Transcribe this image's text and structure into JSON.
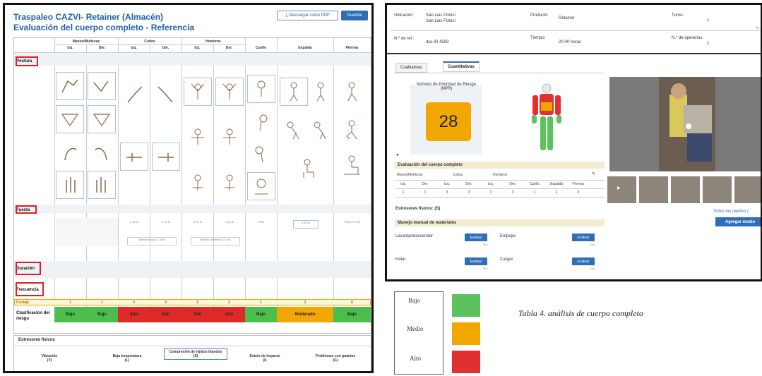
{
  "left": {
    "title1": "Traspaleo CAZVI- Retainer (Almacén)",
    "title2": "Evaluación del cuerpo completo - Referencia",
    "download_label": "Descargar como PDF",
    "save_label": "Guardar",
    "groups": [
      "Manos/Muñecas",
      "Codos",
      "Hombros"
    ],
    "columns": [
      "Izq.",
      "Der.",
      "Izq.",
      "Der.",
      "Izq.",
      "Der.",
      "Cuello",
      "Espalda",
      "Piernas"
    ],
    "sections": {
      "postura": "Postura",
      "fuerza": "Fuerza",
      "duracion": "Duración",
      "frecuencia": "Frecuencia",
      "puntaje": "Puntaje",
      "clasificacion": "Clasificación del riesgo"
    },
    "puntaje_values": [
      "1",
      "1",
      "3",
      "3",
      "3",
      "3",
      "1",
      "2",
      "0"
    ],
    "classification": [
      {
        "label": "Bajo",
        "color": "#4cbe4c"
      },
      {
        "label": "Bajo",
        "color": "#4cbe4c"
      },
      {
        "label": "Alto",
        "color": "#e02a2a"
      },
      {
        "label": "Alto",
        "color": "#e02a2a"
      },
      {
        "label": "Alto",
        "color": "#e02a2a"
      },
      {
        "label": "Alto",
        "color": "#e02a2a"
      },
      {
        "label": "Bajo",
        "color": "#4cbe4c"
      },
      {
        "label": "Moderado",
        "color": "#f0a800"
      },
      {
        "label": "Bajo",
        "color": "#4cbe4c"
      }
    ],
    "stressors_title": "Estresores físicos",
    "stressors": [
      {
        "label": "Vibración",
        "code": "(V)"
      },
      {
        "label": "Baja temperatura",
        "code": "(L)"
      },
      {
        "label": "Compresión de tejidos blandos",
        "code": "(S)"
      },
      {
        "label": "Estrés de impacto",
        "code": "(I)"
      },
      {
        "label": "Problemas con guantes",
        "code": "(G)"
      }
    ]
  },
  "right": {
    "ubicacion_label": "Ubicación:",
    "ubicacion_value1": "San Luis Potosí",
    "ubicacion_value2": "San Luis Potosí",
    "producto_label": "Producto:",
    "producto_value": "Retainer",
    "turno_label": "Turno:",
    "turno_value": "1",
    "ref_label": "N.º de ref.:",
    "ref_value": "doc ID 4593",
    "tiempo_label": "Tiempo:",
    "tiempo_value": "20-40 horas",
    "operarios_label": "N.º de operarios:",
    "operarios_value": "1",
    "tab_cual": "Cualitativas",
    "tab_cuant": "Cuantitativas",
    "npr_label": "Número de Prioridad de Riesgo (NPR)",
    "npr_value": "28",
    "npr_color": "#f0a800",
    "eval_title": "Evaluación del cuerpo completo",
    "eval_groups": [
      "Manos/Muñecas",
      "Codos",
      "Hombros"
    ],
    "eval_cols": [
      "Izq.",
      "Der.",
      "Izq.",
      "Der.",
      "Izq.",
      "Der.",
      "Cuello",
      "Espalda",
      "Piernas"
    ],
    "eval_vals": [
      "1",
      "1",
      "3",
      "3",
      "3",
      "3",
      "1",
      "2",
      "0"
    ],
    "estresores": "Estresores físicos: (S)",
    "manejo_title": "Manejo manual de materiales",
    "items": [
      {
        "label": "Levantar/descender",
        "btn": "Evaluar",
        "na": "N/A"
      },
      {
        "label": "Empujar",
        "btn": "Evaluar",
        "na": "N/A"
      },
      {
        "label": "Halar",
        "btn": "Evaluar",
        "na": "N/A"
      },
      {
        "label": "Cargar",
        "btn": "Evaluar",
        "na": "N/A"
      }
    ],
    "todos_label": "Todos los medios (",
    "agregar_label": "Agregar medio"
  },
  "legend": {
    "bajo": "Bajo",
    "medio": "Medio",
    "alto": "Alto",
    "bajo_color": "#5cc25c",
    "medio_color": "#f0a800",
    "alto_color": "#e03030"
  },
  "caption": "Tabla 4. análisis de cuerpo completo"
}
